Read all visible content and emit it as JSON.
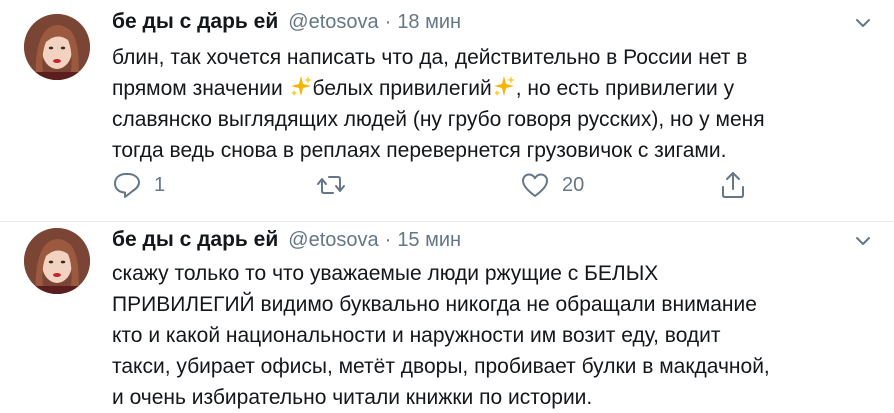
{
  "tweets": [
    {
      "author": {
        "display_name": "бе ды с дарь ей",
        "handle": "@etosova",
        "time": "18 мин"
      },
      "lines": [
        "блин, так хочется написать что да, действительно в России нет в",
        [
          "прямом значении ",
          "sparkles-icon",
          "белых привилегий",
          "sparkles-icon",
          ", но есть привилегии у"
        ],
        "славянско выглядящих людей (ну грубо говоря русских), но у меня",
        "тогда ведь снова в реплаях перевернется грузовичок с зигами."
      ],
      "actions": {
        "reply_count": "1",
        "retweet_count": "",
        "like_count": "20"
      }
    },
    {
      "author": {
        "display_name": "бе ды с дарь ей",
        "handle": "@etosova",
        "time": "15 мин"
      },
      "lines": [
        "скажу только то что уважаемые люди ржущие с БЕЛЫХ",
        "ПРИВИЛЕГИЙ видимо буквально никогда не обращали внимание",
        "кто и какой национальности и наружности им возит еду, водит",
        "такси, убирает офисы, метёт дворы, пробивает булки в макдачной,",
        "и очень избирательно читали книжки по истории."
      ]
    }
  ],
  "separator": "·",
  "icons": {
    "reply": "reply-icon",
    "retweet": "retweet-icon",
    "like": "heart-icon",
    "share": "share-icon",
    "menu": "chevron-down-icon",
    "emoji": "sparkles-icon"
  },
  "colors": {
    "text": "#14171a",
    "secondary": "#657786",
    "divider": "#e6ecf0",
    "sparkles": "#f5b400"
  }
}
